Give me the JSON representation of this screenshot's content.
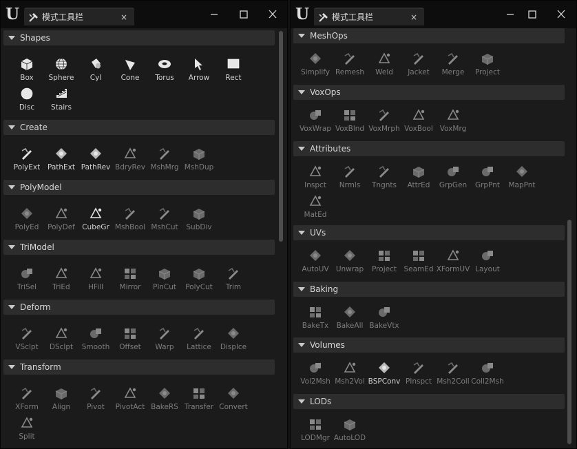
{
  "colors": {
    "bg": "#1b1b1b",
    "titlebar": "#0d0d0d",
    "header": "#2d2d2d",
    "enabled": "#d2d2d2",
    "disabled": "#7d7d7d"
  },
  "left": {
    "tab_title": "模式工具栏",
    "tab_close": "×",
    "sections": [
      {
        "title": "Shapes",
        "tools": [
          {
            "label": "Box",
            "icon": "box-icon",
            "enabled": true
          },
          {
            "label": "Sphere",
            "icon": "sphere-icon",
            "enabled": true
          },
          {
            "label": "Cyl",
            "icon": "cylinder-icon",
            "enabled": true
          },
          {
            "label": "Cone",
            "icon": "cone-icon",
            "enabled": true
          },
          {
            "label": "Torus",
            "icon": "torus-icon",
            "enabled": true
          },
          {
            "label": "Arrow",
            "icon": "arrow-icon",
            "enabled": true
          },
          {
            "label": "Rect",
            "icon": "rect-icon",
            "enabled": true
          },
          {
            "label": "Disc",
            "icon": "disc-icon",
            "enabled": true
          },
          {
            "label": "Stairs",
            "icon": "stairs-icon",
            "enabled": true
          }
        ]
      },
      {
        "title": "Create",
        "tools": [
          {
            "label": "PolyExt",
            "icon": "poly-extrude-icon",
            "enabled": true
          },
          {
            "label": "PathExt",
            "icon": "path-extrude-icon",
            "enabled": true
          },
          {
            "label": "PathRev",
            "icon": "path-revolve-icon",
            "enabled": true
          },
          {
            "label": "BdryRev",
            "icon": "boundary-revolve-icon",
            "enabled": false
          },
          {
            "label": "MshMrg",
            "icon": "mesh-merge-icon",
            "enabled": false
          },
          {
            "label": "MshDup",
            "icon": "mesh-duplicate-icon",
            "enabled": false
          }
        ]
      },
      {
        "title": "PolyModel",
        "tools": [
          {
            "label": "PolyEd",
            "icon": "poly-edit-icon",
            "enabled": false
          },
          {
            "label": "PolyDef",
            "icon": "poly-deform-icon",
            "enabled": false
          },
          {
            "label": "CubeGr",
            "icon": "cube-grid-icon",
            "enabled": true
          },
          {
            "label": "MshBool",
            "icon": "mesh-boolean-icon",
            "enabled": false
          },
          {
            "label": "MshCut",
            "icon": "mesh-cut-icon",
            "enabled": false
          },
          {
            "label": "SubDiv",
            "icon": "subdivide-icon",
            "enabled": false
          }
        ]
      },
      {
        "title": "TriModel",
        "tools": [
          {
            "label": "TriSel",
            "icon": "tri-select-icon",
            "enabled": false
          },
          {
            "label": "TriEd",
            "icon": "tri-edit-icon",
            "enabled": false
          },
          {
            "label": "HFill",
            "icon": "hole-fill-icon",
            "enabled": false
          },
          {
            "label": "Mirror",
            "icon": "mirror-icon",
            "enabled": false
          },
          {
            "label": "PlnCut",
            "icon": "plane-cut-icon",
            "enabled": false
          },
          {
            "label": "PolyCut",
            "icon": "poly-cut-icon",
            "enabled": false
          },
          {
            "label": "Trim",
            "icon": "trim-icon",
            "enabled": false
          }
        ]
      },
      {
        "title": "Deform",
        "tools": [
          {
            "label": "VSclpt",
            "icon": "vertex-sculpt-icon",
            "enabled": false
          },
          {
            "label": "DSclpt",
            "icon": "dyna-sculpt-icon",
            "enabled": false
          },
          {
            "label": "Smooth",
            "icon": "smooth-icon",
            "enabled": false
          },
          {
            "label": "Offset",
            "icon": "offset-icon",
            "enabled": false
          },
          {
            "label": "Warp",
            "icon": "warp-icon",
            "enabled": false
          },
          {
            "label": "Lattice",
            "icon": "lattice-icon",
            "enabled": false
          },
          {
            "label": "Displce",
            "icon": "displace-icon",
            "enabled": false
          }
        ]
      },
      {
        "title": "Transform",
        "tools": [
          {
            "label": "XForm",
            "icon": "transform-icon",
            "enabled": false
          },
          {
            "label": "Align",
            "icon": "align-icon",
            "enabled": false
          },
          {
            "label": "Pivot",
            "icon": "pivot-icon",
            "enabled": false
          },
          {
            "label": "PivotAct",
            "icon": "pivot-actor-icon",
            "enabled": false
          },
          {
            "label": "BakeRS",
            "icon": "bake-rotation-scale-icon",
            "enabled": false
          },
          {
            "label": "Transfer",
            "icon": "transfer-icon",
            "enabled": false
          },
          {
            "label": "Convert",
            "icon": "convert-icon",
            "enabled": false
          },
          {
            "label": "Split",
            "icon": "split-icon",
            "enabled": false
          }
        ]
      }
    ]
  },
  "right": {
    "tab_title": "模式工具栏",
    "tab_close": "×",
    "sections": [
      {
        "title": "MeshOps",
        "tools": [
          {
            "label": "Simplify",
            "icon": "simplify-icon",
            "enabled": false
          },
          {
            "label": "Remesh",
            "icon": "remesh-icon",
            "enabled": false
          },
          {
            "label": "Weld",
            "icon": "weld-icon",
            "enabled": false
          },
          {
            "label": "Jacket",
            "icon": "jacket-icon",
            "enabled": false
          },
          {
            "label": "Merge",
            "icon": "merge-icon",
            "enabled": false
          },
          {
            "label": "Project",
            "icon": "project-icon",
            "enabled": false
          }
        ]
      },
      {
        "title": "VoxOps",
        "tools": [
          {
            "label": "VoxWrap",
            "icon": "vox-wrap-icon",
            "enabled": false
          },
          {
            "label": "VoxBlnd",
            "icon": "vox-blend-icon",
            "enabled": false
          },
          {
            "label": "VoxMrph",
            "icon": "vox-morph-icon",
            "enabled": false
          },
          {
            "label": "VoxBool",
            "icon": "vox-boolean-icon",
            "enabled": false
          },
          {
            "label": "VoxMrg",
            "icon": "vox-merge-icon",
            "enabled": false
          }
        ]
      },
      {
        "title": "Attributes",
        "tools": [
          {
            "label": "Inspct",
            "icon": "inspect-icon",
            "enabled": false
          },
          {
            "label": "Nrmls",
            "icon": "normals-icon",
            "enabled": false
          },
          {
            "label": "Tngnts",
            "icon": "tangents-icon",
            "enabled": false
          },
          {
            "label": "AttrEd",
            "icon": "attribute-edit-icon",
            "enabled": false
          },
          {
            "label": "GrpGen",
            "icon": "group-gen-icon",
            "enabled": false
          },
          {
            "label": "GrpPnt",
            "icon": "group-paint-icon",
            "enabled": false
          },
          {
            "label": "MapPnt",
            "icon": "map-paint-icon",
            "enabled": false
          },
          {
            "label": "MatEd",
            "icon": "material-edit-icon",
            "enabled": false
          }
        ]
      },
      {
        "title": "UVs",
        "tools": [
          {
            "label": "AutoUV",
            "icon": "auto-uv-icon",
            "enabled": false
          },
          {
            "label": "Unwrap",
            "icon": "unwrap-icon",
            "enabled": false
          },
          {
            "label": "Project",
            "icon": "uv-project-icon",
            "enabled": false
          },
          {
            "label": "SeamEd",
            "icon": "seam-edit-icon",
            "enabled": false
          },
          {
            "label": "XFormUV",
            "icon": "transform-uv-icon",
            "enabled": false
          },
          {
            "label": "Layout",
            "icon": "uv-layout-icon",
            "enabled": false
          }
        ]
      },
      {
        "title": "Baking",
        "tools": [
          {
            "label": "BakeTx",
            "icon": "bake-texture-icon",
            "enabled": false
          },
          {
            "label": "BakeAll",
            "icon": "bake-all-icon",
            "enabled": false
          },
          {
            "label": "BakeVtx",
            "icon": "bake-vertex-icon",
            "enabled": false
          }
        ]
      },
      {
        "title": "Volumes",
        "tools": [
          {
            "label": "Vol2Msh",
            "icon": "volume-to-mesh-icon",
            "enabled": false
          },
          {
            "label": "Msh2Vol",
            "icon": "mesh-to-volume-icon",
            "enabled": false
          },
          {
            "label": "BSPConv",
            "icon": "bsp-convert-icon",
            "enabled": true
          },
          {
            "label": "PInspct",
            "icon": "physics-inspect-icon",
            "enabled": false
          },
          {
            "label": "Msh2Coll",
            "icon": "mesh-to-collision-icon",
            "enabled": false
          },
          {
            "label": "Coll2Msh",
            "icon": "collision-to-mesh-icon",
            "enabled": false
          }
        ]
      },
      {
        "title": "LODs",
        "tools": [
          {
            "label": "LODMgr",
            "icon": "lod-manager-icon",
            "enabled": false
          },
          {
            "label": "AutoLOD",
            "icon": "auto-lod-icon",
            "enabled": false
          }
        ]
      }
    ]
  }
}
